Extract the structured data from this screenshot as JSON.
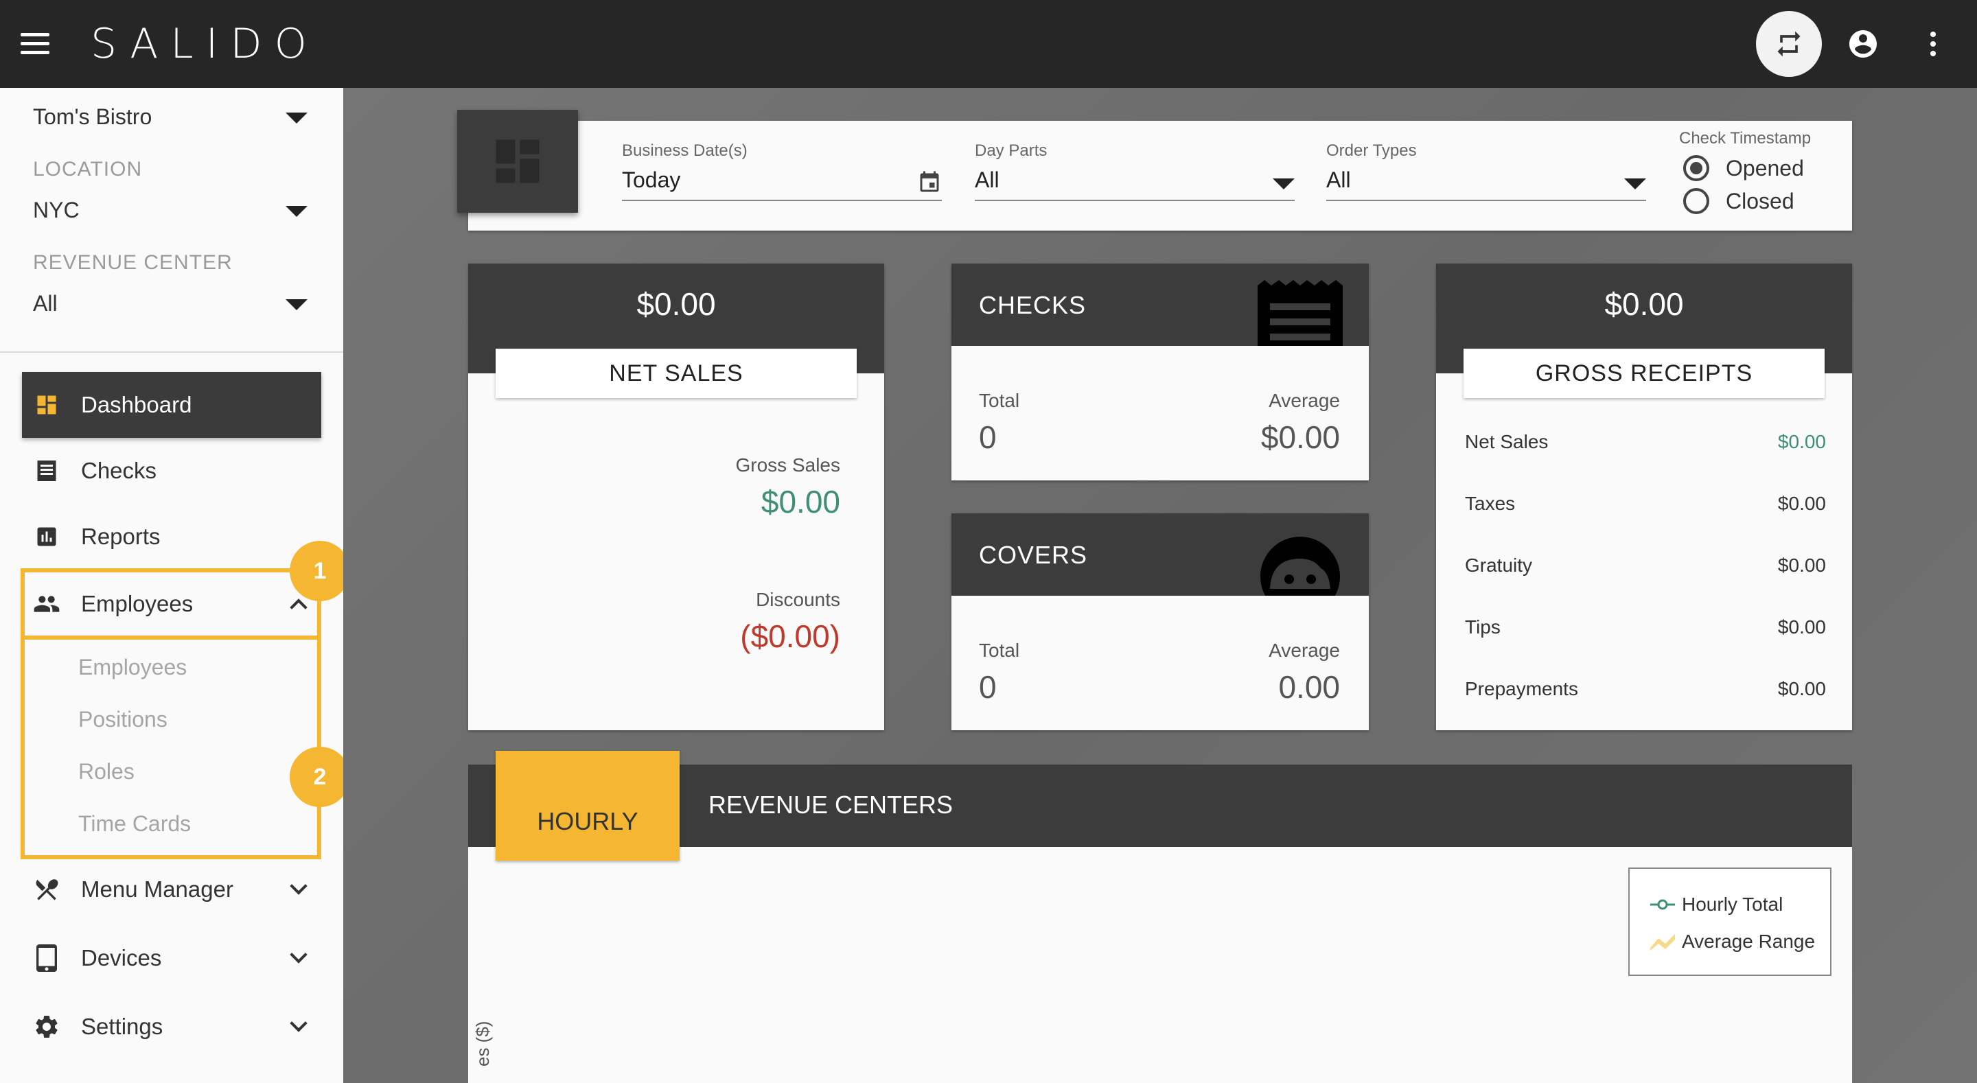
{
  "app": {
    "logo": "SALIDO"
  },
  "sidebar": {
    "restaurant": "Tom's Bistro",
    "location_label": "LOCATION",
    "location_value": "NYC",
    "revenue_center_label": "REVENUE CENTER",
    "revenue_center_value": "All",
    "nav": {
      "dashboard": "Dashboard",
      "checks": "Checks",
      "reports": "Reports",
      "employees": "Employees",
      "menu_manager": "Menu Manager",
      "devices": "Devices",
      "settings": "Settings"
    },
    "employee_sub": [
      "Employees",
      "Positions",
      "Roles",
      "Time Cards"
    ],
    "badges": [
      "1",
      "2"
    ]
  },
  "filters": {
    "business_dates_label": "Business Date(s)",
    "business_dates_value": "Today",
    "day_parts_label": "Day Parts",
    "day_parts_value": "All",
    "order_types_label": "Order Types",
    "order_types_value": "All",
    "check_timestamp_label": "Check Timestamp",
    "opened": "Opened",
    "closed": "Closed"
  },
  "net_sales": {
    "amount": "$0.00",
    "title": "NET SALES",
    "gross_sales_label": "Gross Sales",
    "gross_sales_value": "$0.00",
    "discounts_label": "Discounts",
    "discounts_value": "($0.00)"
  },
  "checks": {
    "title": "CHECKS",
    "total_label": "Total",
    "total_value": "0",
    "average_label": "Average",
    "average_value": "$0.00"
  },
  "covers": {
    "title": "COVERS",
    "total_label": "Total",
    "total_value": "0",
    "average_label": "Average",
    "average_value": "0.00"
  },
  "gross_receipts": {
    "amount": "$0.00",
    "title": "GROSS RECEIPTS",
    "rows": [
      {
        "label": "Net Sales",
        "value": "$0.00"
      },
      {
        "label": "Taxes",
        "value": "$0.00"
      },
      {
        "label": "Gratuity",
        "value": "$0.00"
      },
      {
        "label": "Tips",
        "value": "$0.00"
      },
      {
        "label": "Prepayments",
        "value": "$0.00"
      }
    ]
  },
  "chart_section": {
    "tab_hourly": "HOURLY",
    "tab_revenue_centers": "REVENUE CENTERS",
    "legend_hourly_total": "Hourly Total",
    "legend_average_range": "Average Range",
    "y_axis_label": "es ($)"
  },
  "colors": {
    "accent": "#f5b731",
    "dark": "#3c3c3c",
    "green": "#3f8f73",
    "red": "#c0392b"
  }
}
